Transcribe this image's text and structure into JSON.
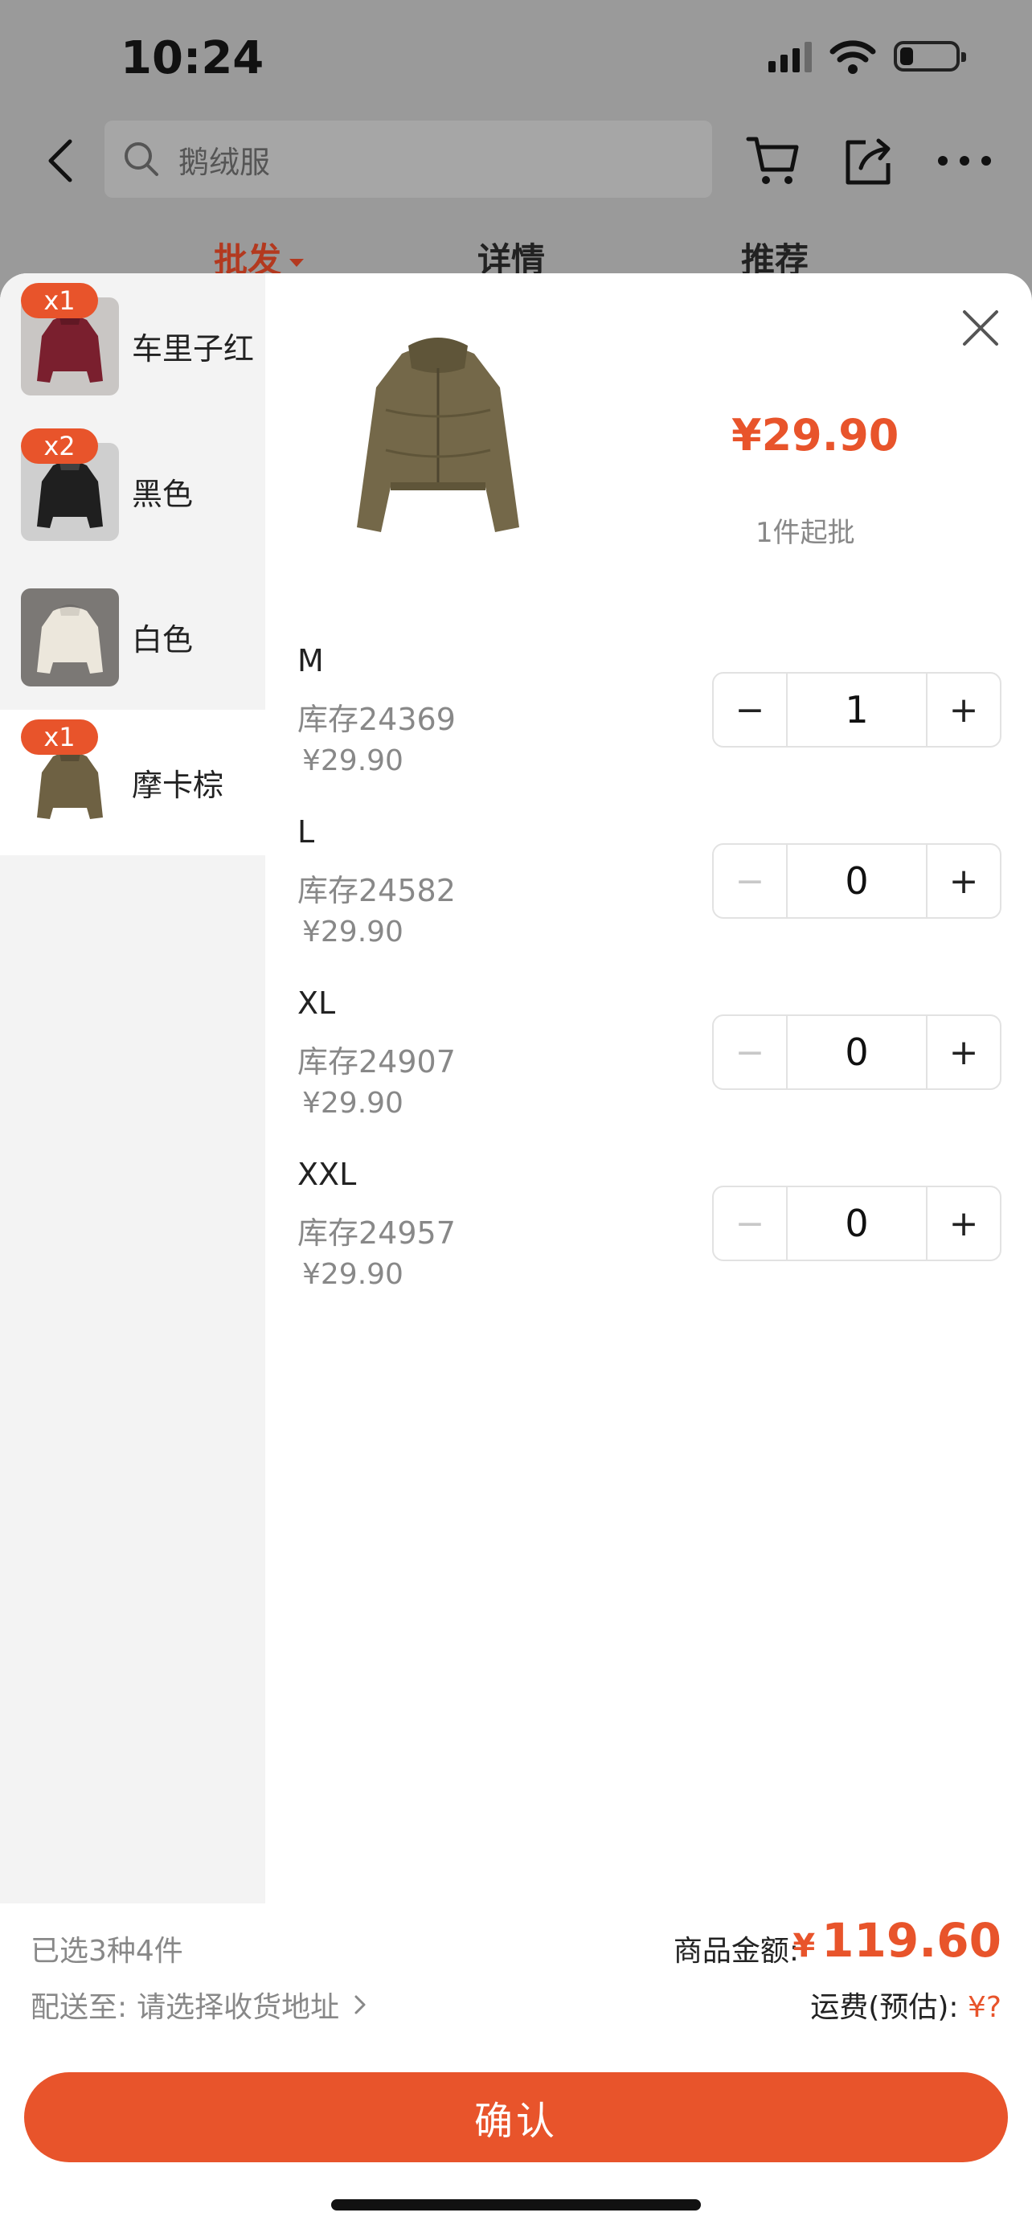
{
  "status": {
    "time": "10:24"
  },
  "search": {
    "placeholder": "鹅绒服"
  },
  "tabs": [
    {
      "label": "批发",
      "active": true
    },
    {
      "label": "详情",
      "active": false
    },
    {
      "label": "推荐",
      "active": false
    }
  ],
  "colors": [
    {
      "label": "车里子红",
      "badge": "x1",
      "swatch": "#7a1f2e",
      "active": false
    },
    {
      "label": "黑色",
      "badge": "x2",
      "swatch": "#1f1f1f",
      "active": false
    },
    {
      "label": "白色",
      "badge": "",
      "swatch": "#ece7dc",
      "active": false
    },
    {
      "label": "摩卡棕",
      "badge": "x1",
      "swatch": "#6e6143",
      "active": true
    }
  ],
  "product": {
    "price": "¥29.90",
    "min_order": "1件起批",
    "image_color": "#746849"
  },
  "sizes": [
    {
      "name": "M",
      "stock": "库存24369",
      "price": "¥29.90",
      "qty": "1",
      "minus_disabled": false
    },
    {
      "name": "L",
      "stock": "库存24582",
      "price": "¥29.90",
      "qty": "0",
      "minus_disabled": true
    },
    {
      "name": "XL",
      "stock": "库存24907",
      "price": "¥29.90",
      "qty": "0",
      "minus_disabled": true
    },
    {
      "name": "XXL",
      "stock": "库存24957",
      "price": "¥29.90",
      "qty": "0",
      "minus_disabled": true
    }
  ],
  "stepper": {
    "minus": "−",
    "plus": "+"
  },
  "footer": {
    "selection_summary": "已选3种4件",
    "ship_to_label": "配送至:",
    "ship_to_value": "请选择收货地址",
    "total_label": "商品金额:",
    "total_currency": "¥",
    "total_value": "119.60",
    "freight_label": "运费(预估):",
    "freight_value": "¥?",
    "confirm_label": "确认"
  },
  "theme": {
    "accent": "#e8542b"
  }
}
